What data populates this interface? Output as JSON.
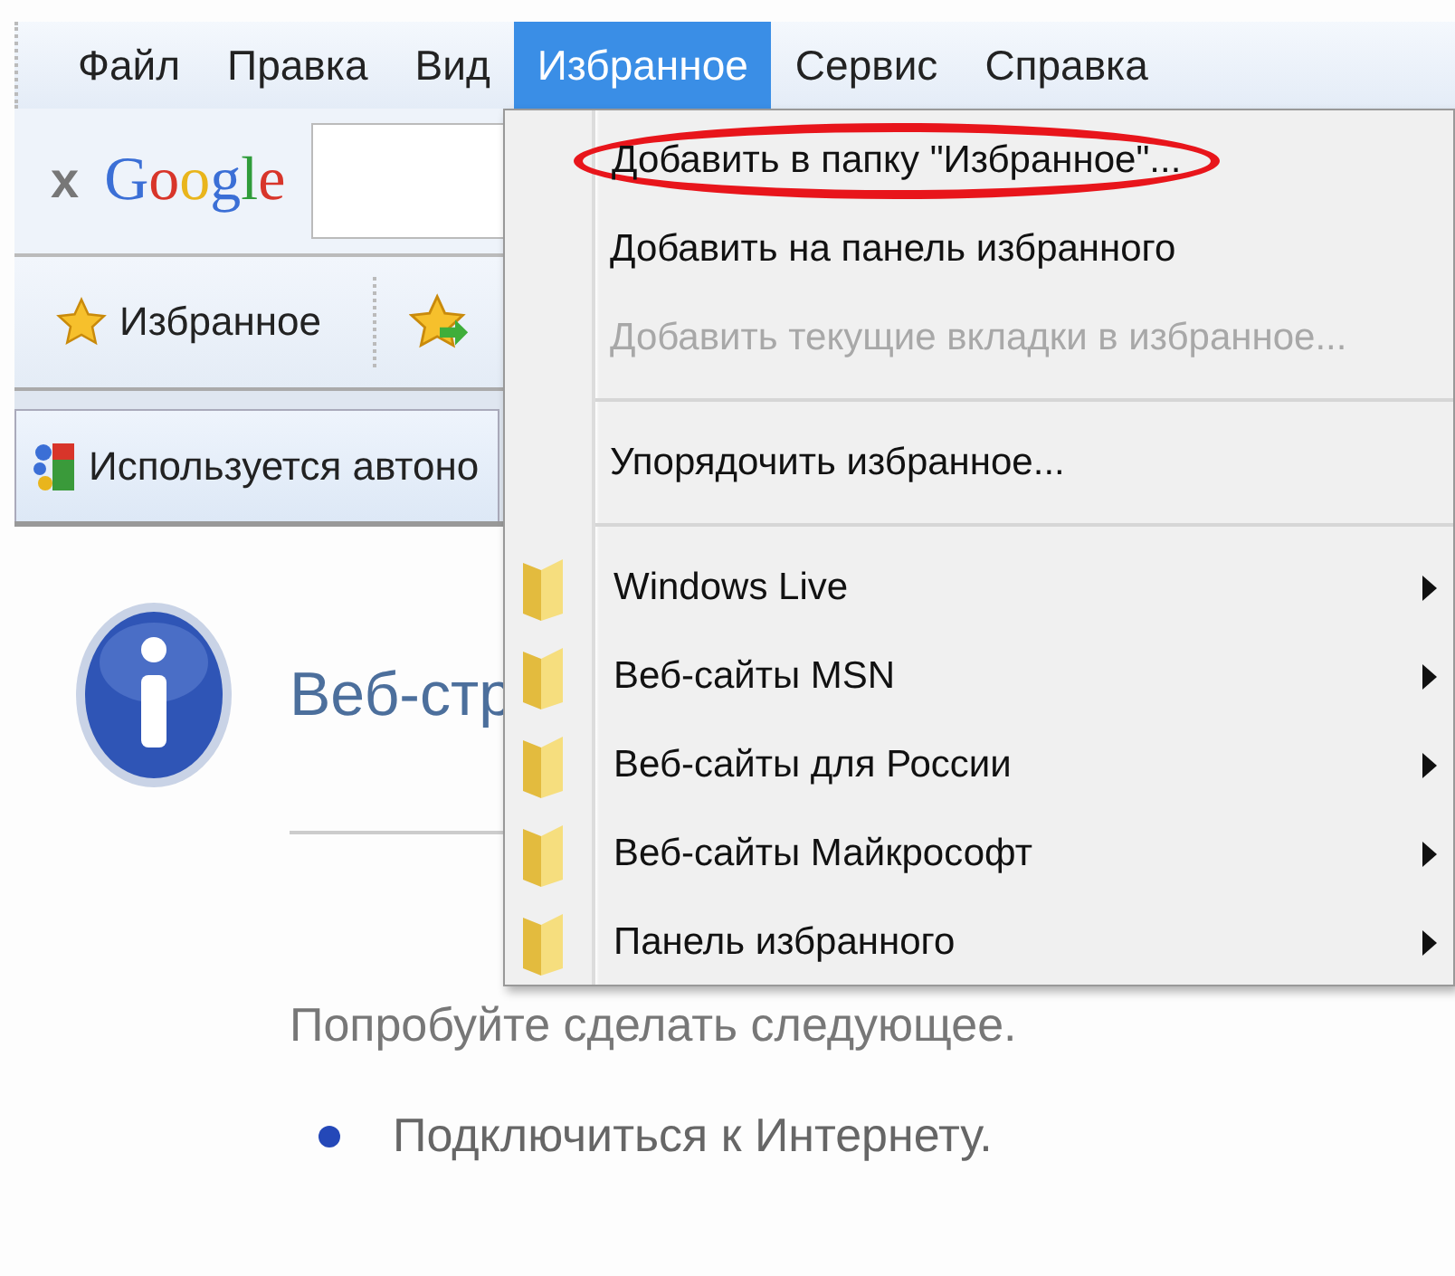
{
  "menubar": [
    {
      "label": "Файл",
      "selected": false
    },
    {
      "label": "Правка",
      "selected": false
    },
    {
      "label": "Вид",
      "selected": false
    },
    {
      "label": "Избранное",
      "selected": true
    },
    {
      "label": "Сервис",
      "selected": false
    },
    {
      "label": "Справка",
      "selected": false
    }
  ],
  "google_bar": {
    "close": "x",
    "logo": "Google"
  },
  "favorites_bar": {
    "label": "Избранное"
  },
  "tab": {
    "title": "Используется автоно"
  },
  "page": {
    "heading": "Веб-стр",
    "tip": "Попробуйте сделать следующее.",
    "bullets": [
      "Подключиться к Интернету."
    ]
  },
  "menu": [
    {
      "kind": "action",
      "label": "Добавить в папку \"Избранное\"...",
      "disabled": false,
      "circled": true
    },
    {
      "kind": "action",
      "label": "Добавить на панель избранного",
      "disabled": false,
      "circled": false
    },
    {
      "kind": "action",
      "label": "Добавить текущие вкладки в избранное...",
      "disabled": true,
      "circled": false
    },
    {
      "kind": "separator"
    },
    {
      "kind": "action",
      "label": "Упорядочить избранное...",
      "disabled": false,
      "circled": false
    },
    {
      "kind": "separator"
    },
    {
      "kind": "folder",
      "label": "Windows Live"
    },
    {
      "kind": "folder",
      "label": "Веб-сайты MSN"
    },
    {
      "kind": "folder",
      "label": "Веб-сайты для России"
    },
    {
      "kind": "folder",
      "label": "Веб-сайты Майкрософт"
    },
    {
      "kind": "folder",
      "label": "Панель избранного"
    }
  ]
}
